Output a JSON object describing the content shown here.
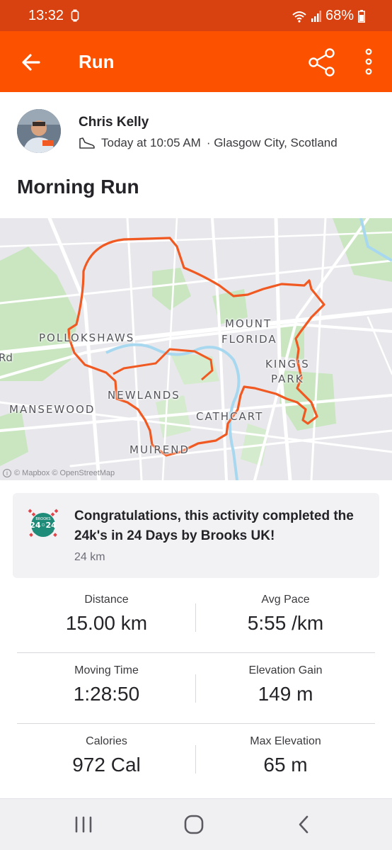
{
  "status_bar": {
    "time": "13:32",
    "battery": "68%",
    "icons": [
      "watch-icon",
      "wifi-icon",
      "signal-icon",
      "battery-icon"
    ]
  },
  "app_bar": {
    "title": "Run",
    "back_icon": "arrow-left-icon",
    "share_icon": "share-icon",
    "more_icon": "more-vertical-icon",
    "color": "#fc5200"
  },
  "activity": {
    "athlete_name": "Chris Kelly",
    "time_text": "Today at 10:05 AM",
    "location_text": "· Glasgow City, Scotland",
    "title": "Morning Run"
  },
  "map": {
    "labels": {
      "pollokshaws": "POLLOKSHAWS",
      "mount": "MOUNT",
      "florida": "FLORIDA",
      "kings": "KING'S",
      "park": "PARK",
      "newlands": "NEWLANDS",
      "mansewood": "MANSEWOOD",
      "cathcart": "CATHCART",
      "muirend": "MUIREND",
      "road": "Rd"
    },
    "attribution": "© Mapbox © OpenStreetMap",
    "route_color": "#f05a22"
  },
  "challenge": {
    "text": "Congratulations, this activity completed the 24k's in 24 Days by Brooks UK!",
    "distance": "24 km",
    "badge_top": "BROOKS",
    "badge_main": "24◦24"
  },
  "stats": [
    {
      "left_label": "Distance",
      "left_value": "15.00 km",
      "right_label": "Avg Pace",
      "right_value": "5:55 /km"
    },
    {
      "left_label": "Moving Time",
      "left_value": "1:28:50",
      "right_label": "Elevation Gain",
      "right_value": "149 m"
    },
    {
      "left_label": "Calories",
      "left_value": "972 Cal",
      "right_label": "Max Elevation",
      "right_value": "65 m"
    }
  ],
  "nav_bar": {
    "icons": [
      "recent-apps-icon",
      "home-icon",
      "back-icon"
    ]
  }
}
